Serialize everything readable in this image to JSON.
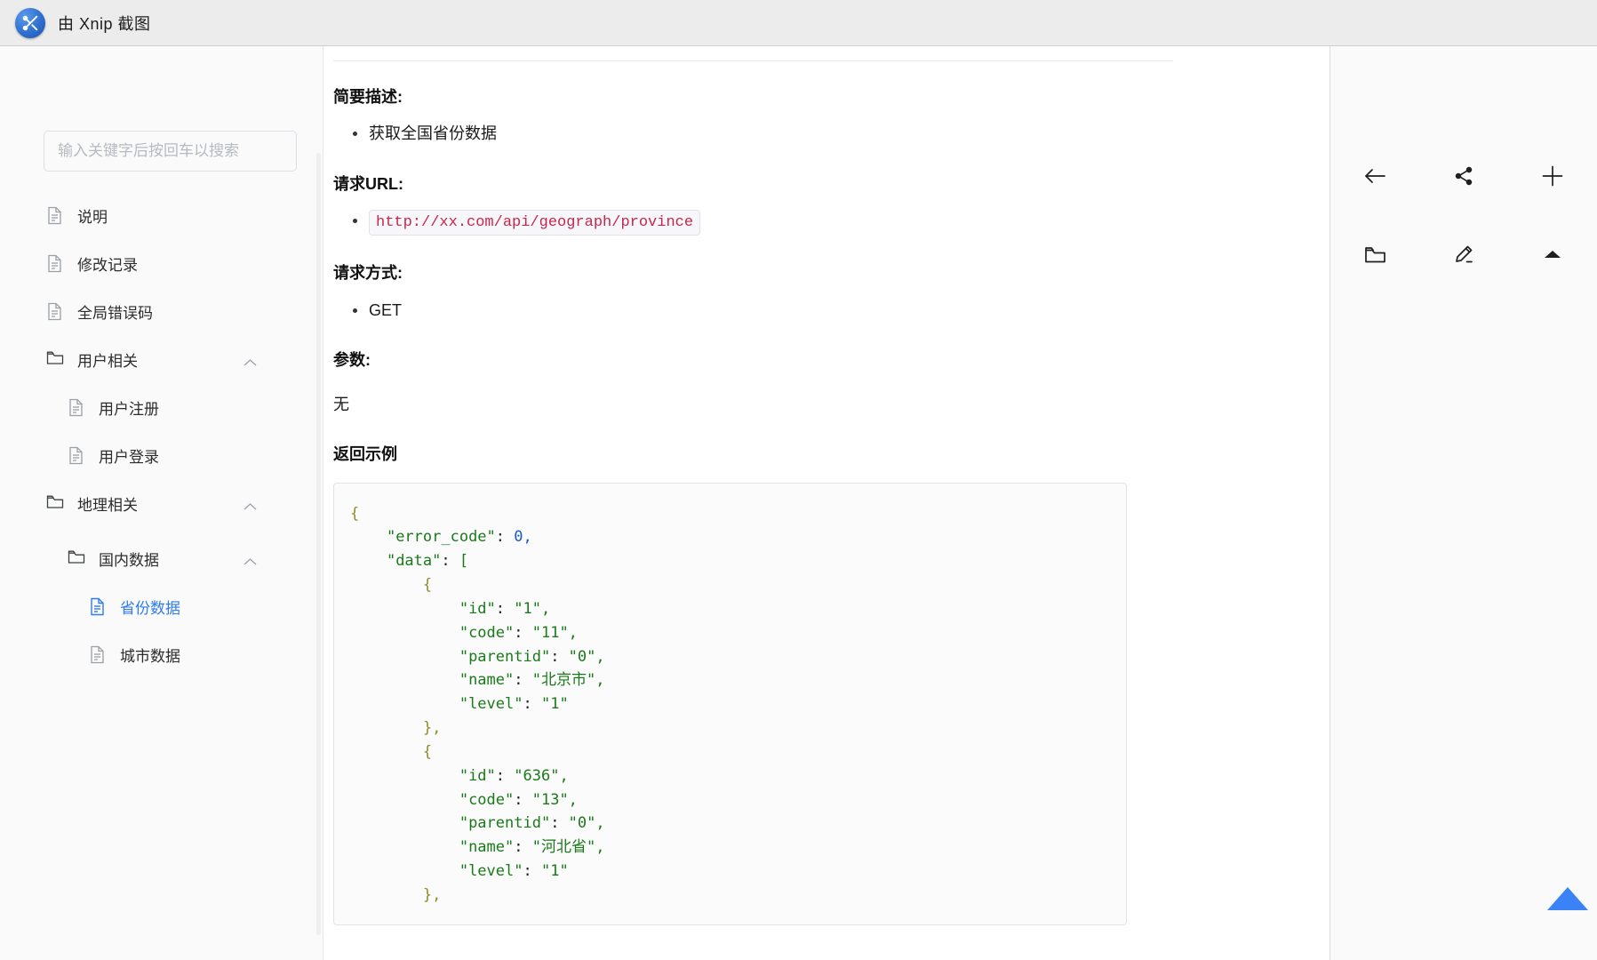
{
  "titlebar": {
    "app_icon": "xnip-scissors-icon",
    "title": "由 Xnip 截图"
  },
  "sidebar": {
    "search": {
      "placeholder": "输入关键字后按回车以搜索",
      "value": ""
    },
    "items": [
      {
        "label": "说明",
        "icon": "document-icon",
        "level": 1,
        "type": "doc",
        "active": false
      },
      {
        "label": "修改记录",
        "icon": "document-icon",
        "level": 1,
        "type": "doc",
        "active": false
      },
      {
        "label": "全局错误码",
        "icon": "document-icon",
        "level": 1,
        "type": "doc",
        "active": false
      },
      {
        "label": "用户相关",
        "icon": "folder-icon",
        "level": 1,
        "type": "folder",
        "active": false,
        "chevron": "chevron-up-icon"
      },
      {
        "label": "用户注册",
        "icon": "document-icon",
        "level": 2,
        "type": "doc",
        "active": false
      },
      {
        "label": "用户登录",
        "icon": "document-icon",
        "level": 2,
        "type": "doc",
        "active": false
      },
      {
        "label": "地理相关",
        "icon": "folder-icon",
        "level": 1,
        "type": "folder",
        "active": false,
        "chevron": "chevron-up-icon"
      },
      {
        "label": "国内数据",
        "icon": "folder-icon",
        "level": 2,
        "type": "folder",
        "active": false,
        "chevron": "chevron-up-icon"
      },
      {
        "label": "省份数据",
        "icon": "document-icon",
        "level": 3,
        "type": "doc",
        "active": true
      },
      {
        "label": "城市数据",
        "icon": "document-icon",
        "level": 3,
        "type": "doc",
        "active": false
      }
    ]
  },
  "document": {
    "sections": {
      "summary_heading": "简要描述:",
      "summary_bullet": "获取全国省份数据",
      "url_heading": "请求URL:",
      "url_value": "http://xx.com/api/geograph/province",
      "method_heading": "请求方式:",
      "method_value": "GET",
      "params_heading": "参数:",
      "params_value": "无",
      "example_heading": "返回示例"
    },
    "code_block": {
      "language": "json",
      "lines": [
        {
          "indent": 0,
          "parts": [
            {
              "t": "{",
              "c": "punct"
            }
          ]
        },
        {
          "indent": 1,
          "parts": [
            {
              "t": "\"error_code\"",
              "c": "key"
            },
            {
              "t": ": ",
              "c": "plain"
            },
            {
              "t": "0",
              "c": "num"
            },
            {
              "t": ",",
              "c": "num"
            }
          ]
        },
        {
          "indent": 1,
          "parts": [
            {
              "t": "\"data\"",
              "c": "key"
            },
            {
              "t": ": ",
              "c": "plain"
            },
            {
              "t": "[",
              "c": "str"
            }
          ]
        },
        {
          "indent": 2,
          "parts": [
            {
              "t": "{",
              "c": "punct"
            }
          ]
        },
        {
          "indent": 3,
          "parts": [
            {
              "t": "\"id\"",
              "c": "key"
            },
            {
              "t": ": ",
              "c": "plain"
            },
            {
              "t": "\"1\",",
              "c": "str"
            }
          ]
        },
        {
          "indent": 3,
          "parts": [
            {
              "t": "\"code\"",
              "c": "key"
            },
            {
              "t": ": ",
              "c": "plain"
            },
            {
              "t": "\"11\",",
              "c": "str"
            }
          ]
        },
        {
          "indent": 3,
          "parts": [
            {
              "t": "\"parentid\"",
              "c": "key"
            },
            {
              "t": ": ",
              "c": "plain"
            },
            {
              "t": "\"0\",",
              "c": "str"
            }
          ]
        },
        {
          "indent": 3,
          "parts": [
            {
              "t": "\"name\"",
              "c": "key"
            },
            {
              "t": ": ",
              "c": "plain"
            },
            {
              "t": "\"北京市\",",
              "c": "str"
            }
          ]
        },
        {
          "indent": 3,
          "parts": [
            {
              "t": "\"level\"",
              "c": "key"
            },
            {
              "t": ": ",
              "c": "plain"
            },
            {
              "t": "\"1\"",
              "c": "str"
            }
          ]
        },
        {
          "indent": 2,
          "parts": [
            {
              "t": "},",
              "c": "punct"
            }
          ]
        },
        {
          "indent": 2,
          "parts": [
            {
              "t": "{",
              "c": "punct"
            }
          ]
        },
        {
          "indent": 3,
          "parts": [
            {
              "t": "\"id\"",
              "c": "key"
            },
            {
              "t": ": ",
              "c": "plain"
            },
            {
              "t": "\"636\",",
              "c": "str"
            }
          ]
        },
        {
          "indent": 3,
          "parts": [
            {
              "t": "\"code\"",
              "c": "key"
            },
            {
              "t": ": ",
              "c": "plain"
            },
            {
              "t": "\"13\",",
              "c": "str"
            }
          ]
        },
        {
          "indent": 3,
          "parts": [
            {
              "t": "\"parentid\"",
              "c": "key"
            },
            {
              "t": ": ",
              "c": "plain"
            },
            {
              "t": "\"0\",",
              "c": "str"
            }
          ]
        },
        {
          "indent": 3,
          "parts": [
            {
              "t": "\"name\"",
              "c": "key"
            },
            {
              "t": ": ",
              "c": "plain"
            },
            {
              "t": "\"河北省\",",
              "c": "str"
            }
          ]
        },
        {
          "indent": 3,
          "parts": [
            {
              "t": "\"level\"",
              "c": "key"
            },
            {
              "t": ": ",
              "c": "plain"
            },
            {
              "t": "\"1\"",
              "c": "str"
            }
          ]
        },
        {
          "indent": 2,
          "parts": [
            {
              "t": "},",
              "c": "punct"
            }
          ]
        }
      ]
    }
  },
  "right_panel": {
    "tools": [
      {
        "name": "back-icon",
        "title": ""
      },
      {
        "name": "share-icon",
        "title": ""
      },
      {
        "name": "add-icon",
        "title": ""
      },
      {
        "name": "folder-icon",
        "title": ""
      },
      {
        "name": "edit-icon",
        "title": ""
      },
      {
        "name": "collapse-up-icon",
        "title": ""
      }
    ],
    "scroll_top_icon": "scroll-to-top-icon"
  },
  "colors": {
    "accent_blue": "#2f7bef",
    "code_url_red": "#c7254e",
    "json_green": "#1a7a1a",
    "json_number_blue": "#1959c6",
    "json_brace_olive": "#8f8c2a",
    "titlebar_bg": "#ececec",
    "sidebar_bg": "#fafafa"
  }
}
